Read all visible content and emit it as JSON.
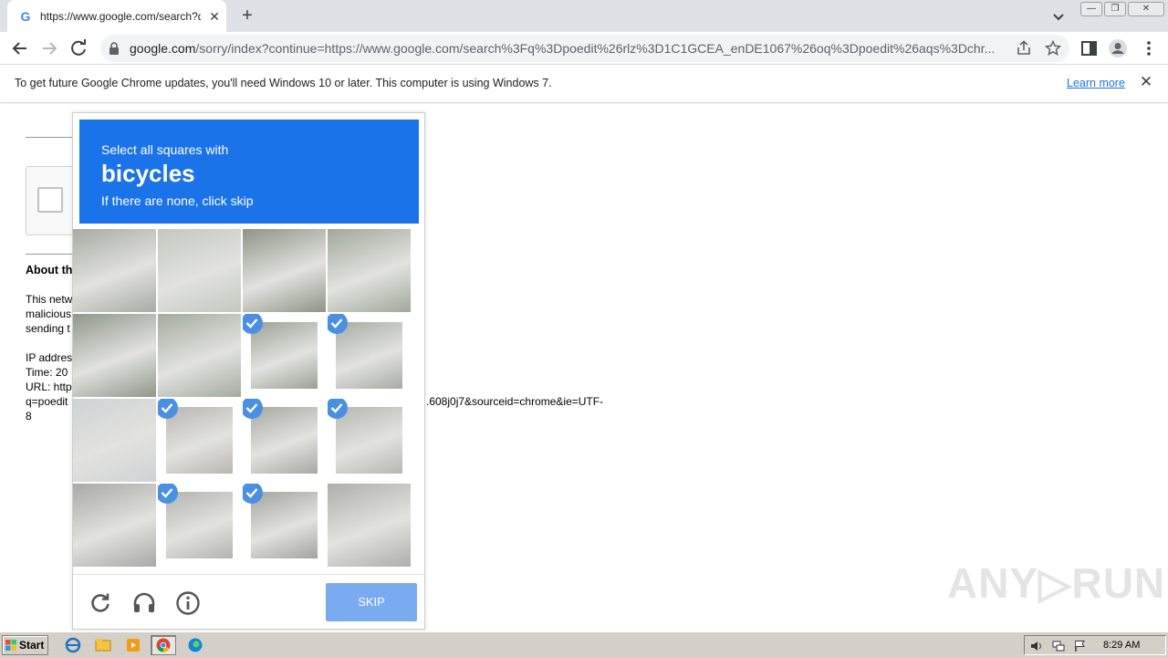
{
  "browser": {
    "tab": {
      "title": "https://www.google.com/search?q=",
      "favicon": "G"
    },
    "url": {
      "host": "google.com",
      "path": "/sorry/index?continue=https://www.google.com/search%3Fq%3Dpoedit%26rlz%3D1C1GCEA_enDE1067%26oq%3Dpoedit%26aqs%3Dchr..."
    },
    "window_controls": {
      "minimize": "—",
      "restore": "❐",
      "close": "✕"
    }
  },
  "infobar": {
    "message": "To get future Google Chrome updates, you'll need Windows 10 or later. This computer is using Windows 7.",
    "link": "Learn more"
  },
  "page": {
    "about_heading": "About th",
    "para_lines": [
      "This netw",
      "malicious",
      "sending t"
    ],
    "info_lines": [
      "IP addres",
      "Time: 20",
      "URL: http",
      "q=poedit",
      "8"
    ],
    "url_tail": ".608j0j7&sourceid=chrome&ie=UTF-",
    "watermark": "ANY▷RUN"
  },
  "captcha": {
    "prompt_line1": "Select all squares with",
    "target": "bicycles",
    "prompt_line3": "If there are none, click skip",
    "selected": [
      6,
      7,
      9,
      10,
      11,
      13,
      14
    ],
    "skip_label": "SKIP",
    "icons": [
      "reload-icon",
      "audio-icon",
      "info-icon"
    ],
    "colors": {
      "header": "#1a73e8",
      "check": "#4a90e2",
      "skip": "#7aabf0"
    }
  },
  "taskbar": {
    "start_label": "Start",
    "clock": "8:29 AM"
  }
}
